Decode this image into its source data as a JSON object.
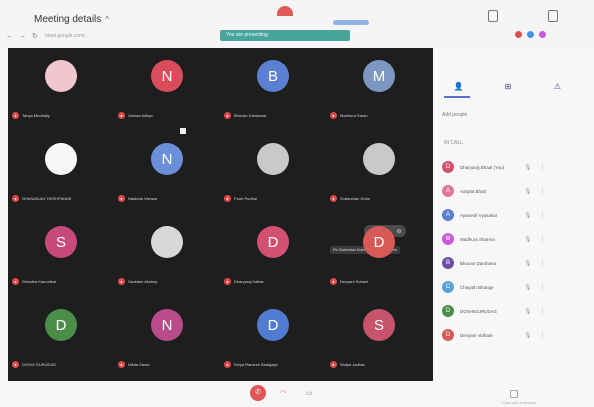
{
  "header": {
    "meeting_title": "Meeting details",
    "url": "meet.google.com/...",
    "share_banner": "You are presenting",
    "url_ext_colors": [
      "#d9534f",
      "#4a90e2",
      "#c95bd6"
    ]
  },
  "stage": {
    "tiles": [
      {
        "initial": "",
        "color": "#f0c7cf",
        "name": "Tanya Mudhaliy",
        "photo": true
      },
      {
        "initial": "N",
        "color": "#d94d5b",
        "name": "Varnaa Aditya"
      },
      {
        "initial": "B",
        "color": "#5a7fd3",
        "name": "Bhuvan Darshana"
      },
      {
        "initial": "M",
        "color": "#7e97c2",
        "name": "Madhura Saran"
      },
      {
        "initial": "",
        "color": "#f7f7f7",
        "name": "DHANANJAY DESHPANDE",
        "photo": true
      },
      {
        "initial": "N",
        "color": "#6b8fd8",
        "name": "Nalanda Vishwa"
      },
      {
        "initial": "",
        "color": "#c9c9c9",
        "name": "Pooh Pudhal",
        "photo": true
      },
      {
        "initial": "",
        "color": "#c9c9c9",
        "name": "Sudarshan Dube",
        "photo": true
      },
      {
        "initial": "S",
        "color": "#c74a7a",
        "name": "Shradha Kamodkar"
      },
      {
        "initial": "",
        "color": "#d8d8d8",
        "name": "Gaddam Akshay",
        "photo": true
      },
      {
        "initial": "D",
        "color": "#d45071",
        "name": "Dharyaraj Kalkar"
      },
      {
        "initial": "D",
        "color": "#d65a55",
        "name": "Devyani Sohani"
      },
      {
        "initial": "D",
        "color": "#4a8e4a",
        "name": "DOSHI GURUDAS"
      },
      {
        "initial": "N",
        "color": "#b84b8a",
        "name": "Nikita Sarav"
      },
      {
        "initial": "D",
        "color": "#4f7bd1",
        "name": "Divya Ramesh Bhalgaye"
      },
      {
        "initial": "S",
        "color": "#c8536c",
        "name": "Shilpa Jadhav"
      }
    ],
    "overlay_text": "Pin Sudarshan Dube to your main screen"
  },
  "panel": {
    "tabs": [
      "👤",
      "⊞",
      "⚠"
    ],
    "add_people": "Add people",
    "section_label": "IN CALL",
    "people": [
      {
        "name": "Dharyaraj Bhaal (You)",
        "color": "#d45071",
        "initial": "D"
      },
      {
        "name": "Aarpita Bhatt",
        "color": "#e07799",
        "initial": "A"
      },
      {
        "name": "Ayanesh Vyasakar",
        "color": "#5a7fd3",
        "initial": "A"
      },
      {
        "name": "Madhura Sharma",
        "color": "#c95bd6",
        "initial": "M"
      },
      {
        "name": "Bhuvan Darshana",
        "color": "#6b4fa8",
        "initial": "B"
      },
      {
        "name": "Chayath Bhange",
        "color": "#5aa3d6",
        "initial": "C"
      },
      {
        "name": "DOSHIGURUDAS",
        "color": "#4a8e4a",
        "initial": "D"
      },
      {
        "name": "Devyani Vidhate",
        "color": "#d65a55",
        "initial": "D"
      }
    ],
    "bottom_label": "Chat with everyone"
  },
  "controls": {
    "end_icon": "✆",
    "cc_icon": "◠",
    "present_icon": "▭"
  }
}
